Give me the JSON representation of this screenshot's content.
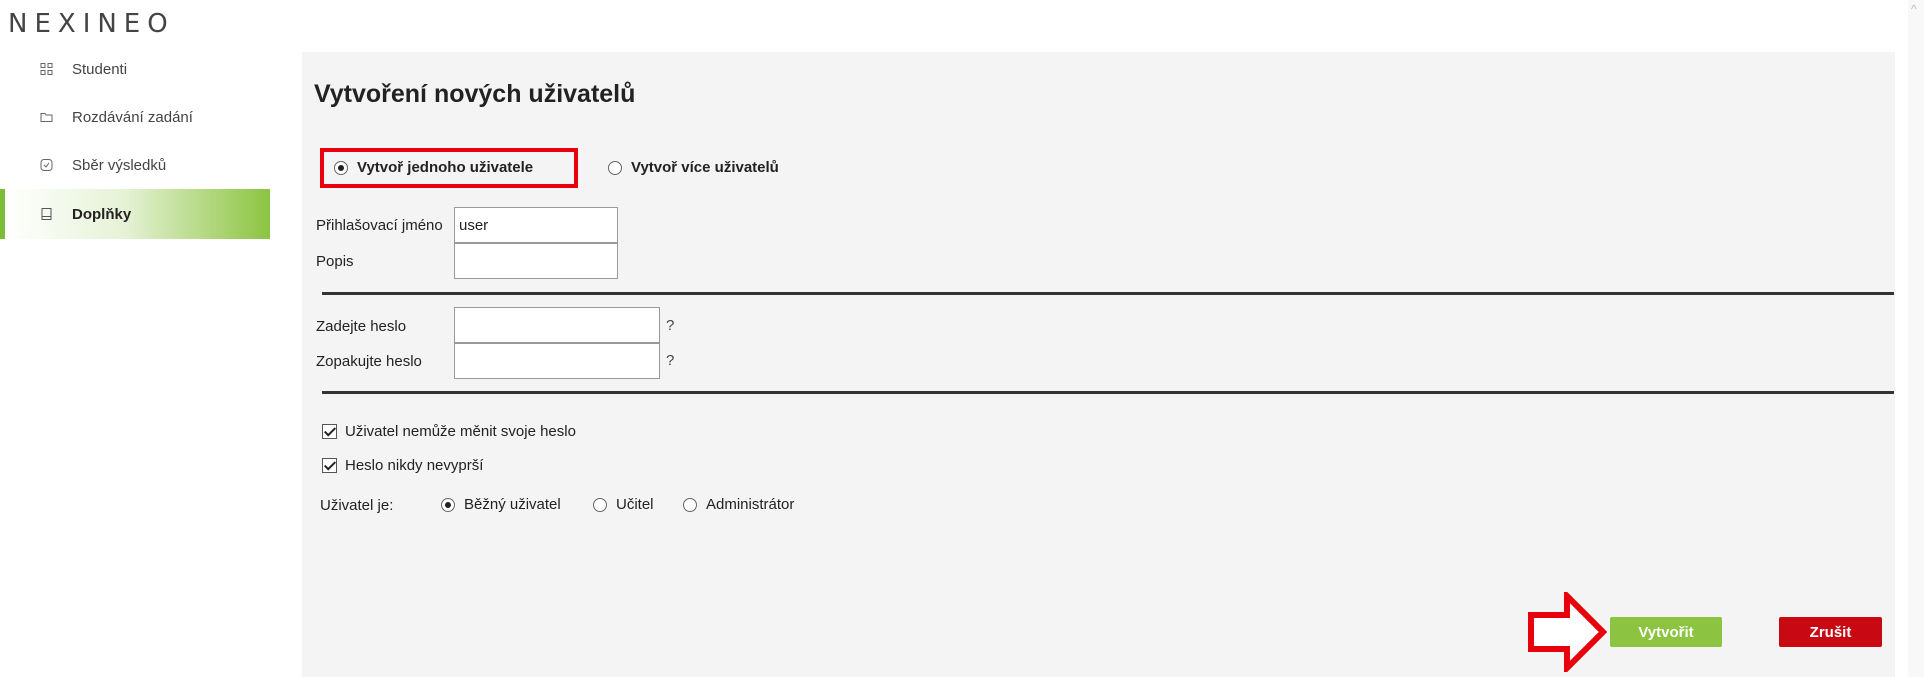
{
  "app": {
    "logo": "NEXINEO"
  },
  "sidebar": {
    "items": [
      {
        "label": "Studenti",
        "icon": "grid-icon"
      },
      {
        "label": "Rozdávání zadání",
        "icon": "folder-icon"
      },
      {
        "label": "Sběr výsledků",
        "icon": "check-circle-icon"
      },
      {
        "label": "Doplňky",
        "icon": "book-icon",
        "active": true
      }
    ]
  },
  "page": {
    "title": "Vytvoření nových uživatelů"
  },
  "mode": {
    "single_label": "Vytvoř jednoho uživatele",
    "multi_label": "Vytvoř více uživatelů",
    "selected": "single"
  },
  "form": {
    "login_label": "Přihlašovací jméno",
    "login_value": "user",
    "desc_label": "Popis",
    "desc_value": "",
    "pwd_label": "Zadejte heslo",
    "pwd_repeat_label": "Zopakujte heslo",
    "help_mark": "?"
  },
  "options": {
    "cannot_change_label": "Uživatel nemůže měnit svoje heslo",
    "cannot_change_checked": true,
    "never_expires_label": "Heslo nikdy nevyprší",
    "never_expires_checked": true
  },
  "role": {
    "label": "Uživatel je:",
    "options": [
      "Běžný uživatel",
      "Učitel",
      "Administrátor"
    ],
    "selected": "Běžný uživatel"
  },
  "actions": {
    "create_label": "Vytvořit",
    "cancel_label": "Zrušit"
  },
  "colors": {
    "accent_green": "#8cc441",
    "danger_red": "#c80812",
    "highlight_red": "#e8000c"
  }
}
